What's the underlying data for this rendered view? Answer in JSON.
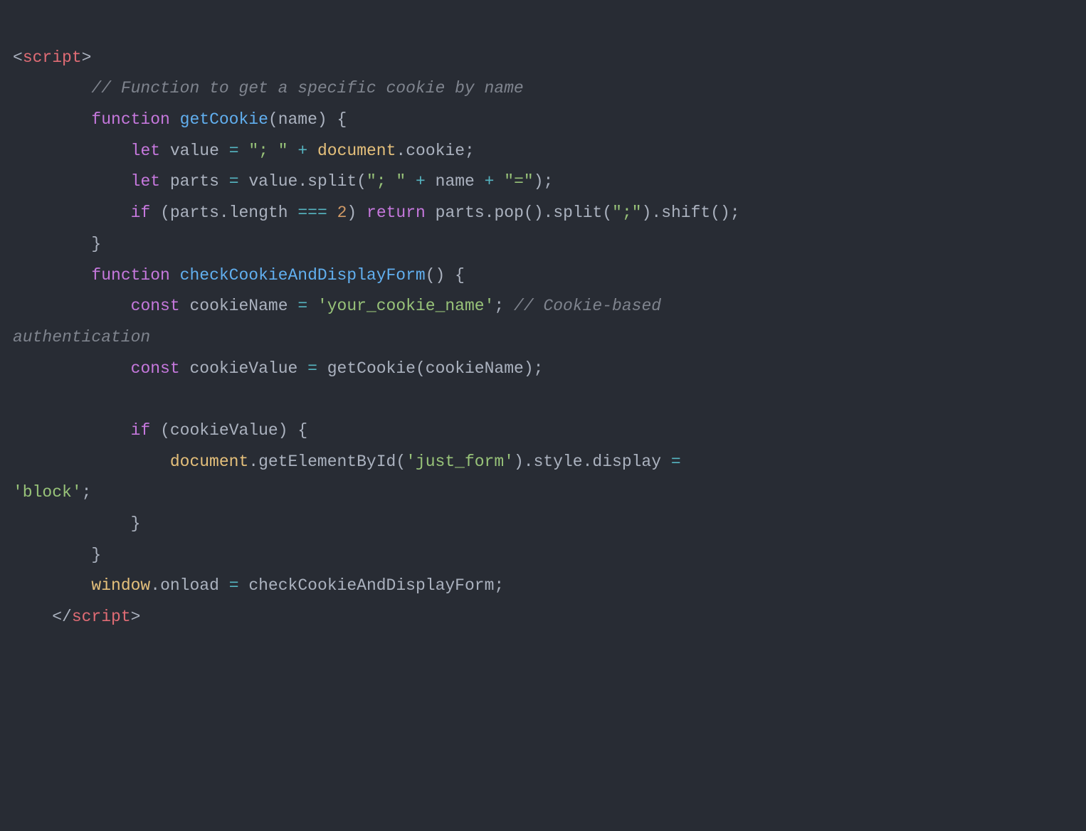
{
  "code": {
    "lines": [
      {
        "indent": 0,
        "tokens": [
          {
            "t": "<",
            "c": "punc"
          },
          {
            "t": "script",
            "c": "tag"
          },
          {
            "t": ">",
            "c": "punc"
          }
        ]
      },
      {
        "indent": 8,
        "tokens": [
          {
            "t": "// Function to get a specific cookie by name",
            "c": "comment"
          }
        ]
      },
      {
        "indent": 8,
        "tokens": [
          {
            "t": "function",
            "c": "keyword"
          },
          {
            "t": " ",
            "c": "plain"
          },
          {
            "t": "getCookie",
            "c": "fn"
          },
          {
            "t": "(",
            "c": "punc"
          },
          {
            "t": "name",
            "c": "param"
          },
          {
            "t": ")",
            "c": "punc"
          },
          {
            "t": " ",
            "c": "plain"
          },
          {
            "t": "{",
            "c": "punc"
          }
        ]
      },
      {
        "indent": 12,
        "tokens": [
          {
            "t": "let",
            "c": "keyword"
          },
          {
            "t": " ",
            "c": "plain"
          },
          {
            "t": "value",
            "c": "plain"
          },
          {
            "t": " ",
            "c": "plain"
          },
          {
            "t": "=",
            "c": "op"
          },
          {
            "t": " ",
            "c": "plain"
          },
          {
            "t": "\"; \"",
            "c": "string"
          },
          {
            "t": " ",
            "c": "plain"
          },
          {
            "t": "+",
            "c": "op"
          },
          {
            "t": " ",
            "c": "plain"
          },
          {
            "t": "document",
            "c": "var"
          },
          {
            "t": ".",
            "c": "punc"
          },
          {
            "t": "cookie",
            "c": "plain"
          },
          {
            "t": ";",
            "c": "punc"
          }
        ]
      },
      {
        "indent": 12,
        "tokens": [
          {
            "t": "let",
            "c": "keyword"
          },
          {
            "t": " ",
            "c": "plain"
          },
          {
            "t": "parts",
            "c": "plain"
          },
          {
            "t": " ",
            "c": "plain"
          },
          {
            "t": "=",
            "c": "op"
          },
          {
            "t": " ",
            "c": "plain"
          },
          {
            "t": "value",
            "c": "plain"
          },
          {
            "t": ".",
            "c": "punc"
          },
          {
            "t": "split",
            "c": "call"
          },
          {
            "t": "(",
            "c": "punc"
          },
          {
            "t": "\"; \"",
            "c": "string"
          },
          {
            "t": " ",
            "c": "plain"
          },
          {
            "t": "+",
            "c": "op"
          },
          {
            "t": " ",
            "c": "plain"
          },
          {
            "t": "name",
            "c": "plain"
          },
          {
            "t": " ",
            "c": "plain"
          },
          {
            "t": "+",
            "c": "op"
          },
          {
            "t": " ",
            "c": "plain"
          },
          {
            "t": "\"=\"",
            "c": "string"
          },
          {
            "t": ")",
            "c": "punc"
          },
          {
            "t": ";",
            "c": "punc"
          }
        ]
      },
      {
        "indent": 12,
        "tokens": [
          {
            "t": "if",
            "c": "keyword"
          },
          {
            "t": " ",
            "c": "plain"
          },
          {
            "t": "(",
            "c": "punc"
          },
          {
            "t": "parts",
            "c": "plain"
          },
          {
            "t": ".",
            "c": "punc"
          },
          {
            "t": "length",
            "c": "plain"
          },
          {
            "t": " ",
            "c": "plain"
          },
          {
            "t": "===",
            "c": "op"
          },
          {
            "t": " ",
            "c": "plain"
          },
          {
            "t": "2",
            "c": "num"
          },
          {
            "t": ")",
            "c": "punc"
          },
          {
            "t": " ",
            "c": "plain"
          },
          {
            "t": "return",
            "c": "keyword"
          },
          {
            "t": " ",
            "c": "plain"
          },
          {
            "t": "parts",
            "c": "plain"
          },
          {
            "t": ".",
            "c": "punc"
          },
          {
            "t": "pop",
            "c": "call"
          },
          {
            "t": "()",
            "c": "punc"
          },
          {
            "t": ".",
            "c": "punc"
          },
          {
            "t": "split",
            "c": "call"
          },
          {
            "t": "(",
            "c": "punc"
          },
          {
            "t": "\";\"",
            "c": "string"
          },
          {
            "t": ")",
            "c": "punc"
          },
          {
            "t": ".",
            "c": "punc"
          },
          {
            "t": "shift",
            "c": "call"
          },
          {
            "t": "()",
            "c": "punc"
          },
          {
            "t": ";",
            "c": "punc"
          }
        ]
      },
      {
        "indent": 8,
        "tokens": [
          {
            "t": "}",
            "c": "punc"
          }
        ]
      },
      {
        "indent": 8,
        "tokens": [
          {
            "t": "function",
            "c": "keyword"
          },
          {
            "t": " ",
            "c": "plain"
          },
          {
            "t": "checkCookieAndDisplayForm",
            "c": "fn"
          },
          {
            "t": "()",
            "c": "punc"
          },
          {
            "t": " ",
            "c": "plain"
          },
          {
            "t": "{",
            "c": "punc"
          }
        ]
      },
      {
        "indent": 12,
        "tokens": [
          {
            "t": "const",
            "c": "keyword"
          },
          {
            "t": " ",
            "c": "plain"
          },
          {
            "t": "cookieName",
            "c": "plain"
          },
          {
            "t": " ",
            "c": "plain"
          },
          {
            "t": "=",
            "c": "op"
          },
          {
            "t": " ",
            "c": "plain"
          },
          {
            "t": "'your_cookie_name'",
            "c": "string"
          },
          {
            "t": ";",
            "c": "punc"
          },
          {
            "t": " ",
            "c": "plain"
          },
          {
            "t": "// Cookie-based",
            "c": "comment"
          }
        ]
      },
      {
        "indent": 0,
        "tokens": [
          {
            "t": "authentication",
            "c": "comment"
          }
        ]
      },
      {
        "indent": 12,
        "tokens": [
          {
            "t": "const",
            "c": "keyword"
          },
          {
            "t": " ",
            "c": "plain"
          },
          {
            "t": "cookieValue",
            "c": "plain"
          },
          {
            "t": " ",
            "c": "plain"
          },
          {
            "t": "=",
            "c": "op"
          },
          {
            "t": " ",
            "c": "plain"
          },
          {
            "t": "getCookie",
            "c": "call"
          },
          {
            "t": "(",
            "c": "punc"
          },
          {
            "t": "cookieName",
            "c": "plain"
          },
          {
            "t": ")",
            "c": "punc"
          },
          {
            "t": ";",
            "c": "punc"
          }
        ]
      },
      {
        "indent": 0,
        "tokens": [
          {
            "t": "",
            "c": "plain"
          }
        ]
      },
      {
        "indent": 12,
        "tokens": [
          {
            "t": "if",
            "c": "keyword"
          },
          {
            "t": " ",
            "c": "plain"
          },
          {
            "t": "(",
            "c": "punc"
          },
          {
            "t": "cookieValue",
            "c": "plain"
          },
          {
            "t": ")",
            "c": "punc"
          },
          {
            "t": " ",
            "c": "plain"
          },
          {
            "t": "{",
            "c": "punc"
          }
        ]
      },
      {
        "indent": 16,
        "tokens": [
          {
            "t": "document",
            "c": "var"
          },
          {
            "t": ".",
            "c": "punc"
          },
          {
            "t": "getElementById",
            "c": "call"
          },
          {
            "t": "(",
            "c": "punc"
          },
          {
            "t": "'just_form'",
            "c": "string"
          },
          {
            "t": ")",
            "c": "punc"
          },
          {
            "t": ".",
            "c": "punc"
          },
          {
            "t": "style",
            "c": "plain"
          },
          {
            "t": ".",
            "c": "punc"
          },
          {
            "t": "display",
            "c": "plain"
          },
          {
            "t": " ",
            "c": "plain"
          },
          {
            "t": "=",
            "c": "op"
          }
        ]
      },
      {
        "indent": 0,
        "tokens": [
          {
            "t": "'block'",
            "c": "string"
          },
          {
            "t": ";",
            "c": "punc"
          }
        ]
      },
      {
        "indent": 12,
        "tokens": [
          {
            "t": "}",
            "c": "punc"
          }
        ]
      },
      {
        "indent": 8,
        "tokens": [
          {
            "t": "}",
            "c": "punc"
          }
        ]
      },
      {
        "indent": 8,
        "tokens": [
          {
            "t": "window",
            "c": "var"
          },
          {
            "t": ".",
            "c": "punc"
          },
          {
            "t": "onload",
            "c": "plain"
          },
          {
            "t": " ",
            "c": "plain"
          },
          {
            "t": "=",
            "c": "op"
          },
          {
            "t": " ",
            "c": "plain"
          },
          {
            "t": "checkCookieAndDisplayForm",
            "c": "plain"
          },
          {
            "t": ";",
            "c": "punc"
          }
        ]
      },
      {
        "indent": 4,
        "tokens": [
          {
            "t": "</",
            "c": "punc"
          },
          {
            "t": "script",
            "c": "tag"
          },
          {
            "t": ">",
            "c": "punc"
          }
        ]
      }
    ]
  }
}
